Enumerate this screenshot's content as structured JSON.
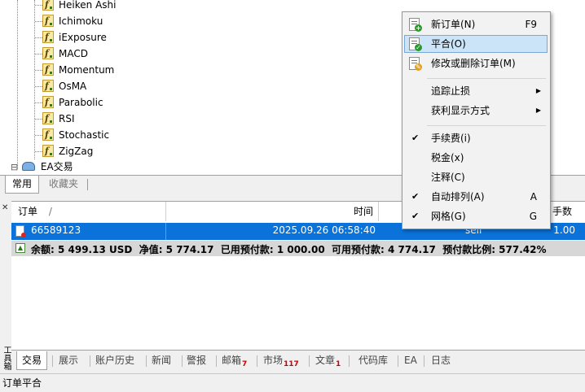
{
  "navigator": {
    "indicators": [
      "Heiken Ashi",
      "Ichimoku",
      "iExposure",
      "MACD",
      "Momentum",
      "OsMA",
      "Parabolic",
      "RSI",
      "Stochastic",
      "ZigZag"
    ],
    "ea_folder": "EA交易",
    "expand_glyph": "⊟"
  },
  "nav_tabs": [
    {
      "label": "常用",
      "active": true
    },
    {
      "label": "收藏夹",
      "active": false
    }
  ],
  "terminal": {
    "side_label": "工具箱",
    "columns": {
      "order": "订单",
      "sort_marker": "/",
      "time": "时间",
      "lots_partial": "手数"
    },
    "order": {
      "id": "66589123",
      "time": "2025.09.26 06:58:40",
      "type": "sell",
      "lots": "1.00"
    },
    "summary": "余额: 5 499.13 USD  净值: 5 774.17  已用预付款: 1 000.00  可用预付款: 4 774.17  预付款比例: 577.42%"
  },
  "terminal_tabs": [
    {
      "label": "交易",
      "active": true,
      "count": ""
    },
    {
      "label": "展示",
      "active": false,
      "count": ""
    },
    {
      "label": "账户历史",
      "active": false,
      "count": ""
    },
    {
      "label": "新闻",
      "active": false,
      "count": ""
    },
    {
      "label": "警报",
      "active": false,
      "count": ""
    },
    {
      "label": "邮箱",
      "active": false,
      "count": "7"
    },
    {
      "label": "市场",
      "active": false,
      "count": "117"
    },
    {
      "label": "文章",
      "active": false,
      "count": "1"
    },
    {
      "label": "代码库",
      "active": false,
      "count": ""
    },
    {
      "label": "EA",
      "active": false,
      "count": ""
    },
    {
      "label": "日志",
      "active": false,
      "count": ""
    }
  ],
  "status": {
    "text": "订单平合"
  },
  "context_menu": {
    "items": [
      {
        "label": "新订单(N)",
        "shortcut": "F9",
        "icon": "new-order-icon"
      },
      {
        "label": "平合(O)",
        "shortcut": "",
        "icon": "close-order-icon",
        "highlighted": true
      },
      {
        "label": "修改或删除订单(M)",
        "shortcut": "",
        "icon": "modify-order-icon"
      },
      {
        "label": "追踪止损",
        "submenu": true
      },
      {
        "label": "获利显示方式",
        "submenu": true
      },
      {
        "label": "手续费(i)",
        "checked": true
      },
      {
        "label": "税金(x)",
        "checked": false
      },
      {
        "label": "注释(C)",
        "checked": false
      },
      {
        "label": "自动排列(A)",
        "shortcut": "A",
        "checked": true
      },
      {
        "label": "网格(G)",
        "shortcut": "G",
        "checked": true
      }
    ],
    "check_glyph": "✔",
    "arrow_glyph": "▶"
  },
  "colors": {
    "selection": "#0a72d8",
    "menu_highlight": "#cce4f7",
    "summary_bg": "#d7d7d7",
    "count_red": "#cc0000"
  }
}
